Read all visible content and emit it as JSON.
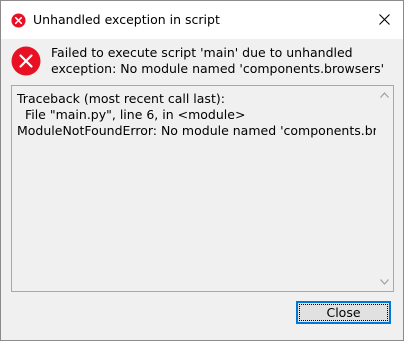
{
  "window": {
    "title": "Unhandled exception in script",
    "title_icon": "error-icon"
  },
  "message": {
    "icon": "error-icon",
    "text": "Failed to execute script 'main' due to unhandled exception: No module named 'components.browsers'"
  },
  "details": {
    "text": "Traceback (most recent call last):\n  File \"main.py\", line 6, in <module>\nModuleNotFoundError: No module named 'components.browsers'"
  },
  "buttons": {
    "close_label": "Close"
  },
  "colors": {
    "error_red": "#e81123",
    "focus_blue": "#0078d7",
    "dialog_bg": "#f0f0f0",
    "titlebar_bg": "#ffffff"
  }
}
